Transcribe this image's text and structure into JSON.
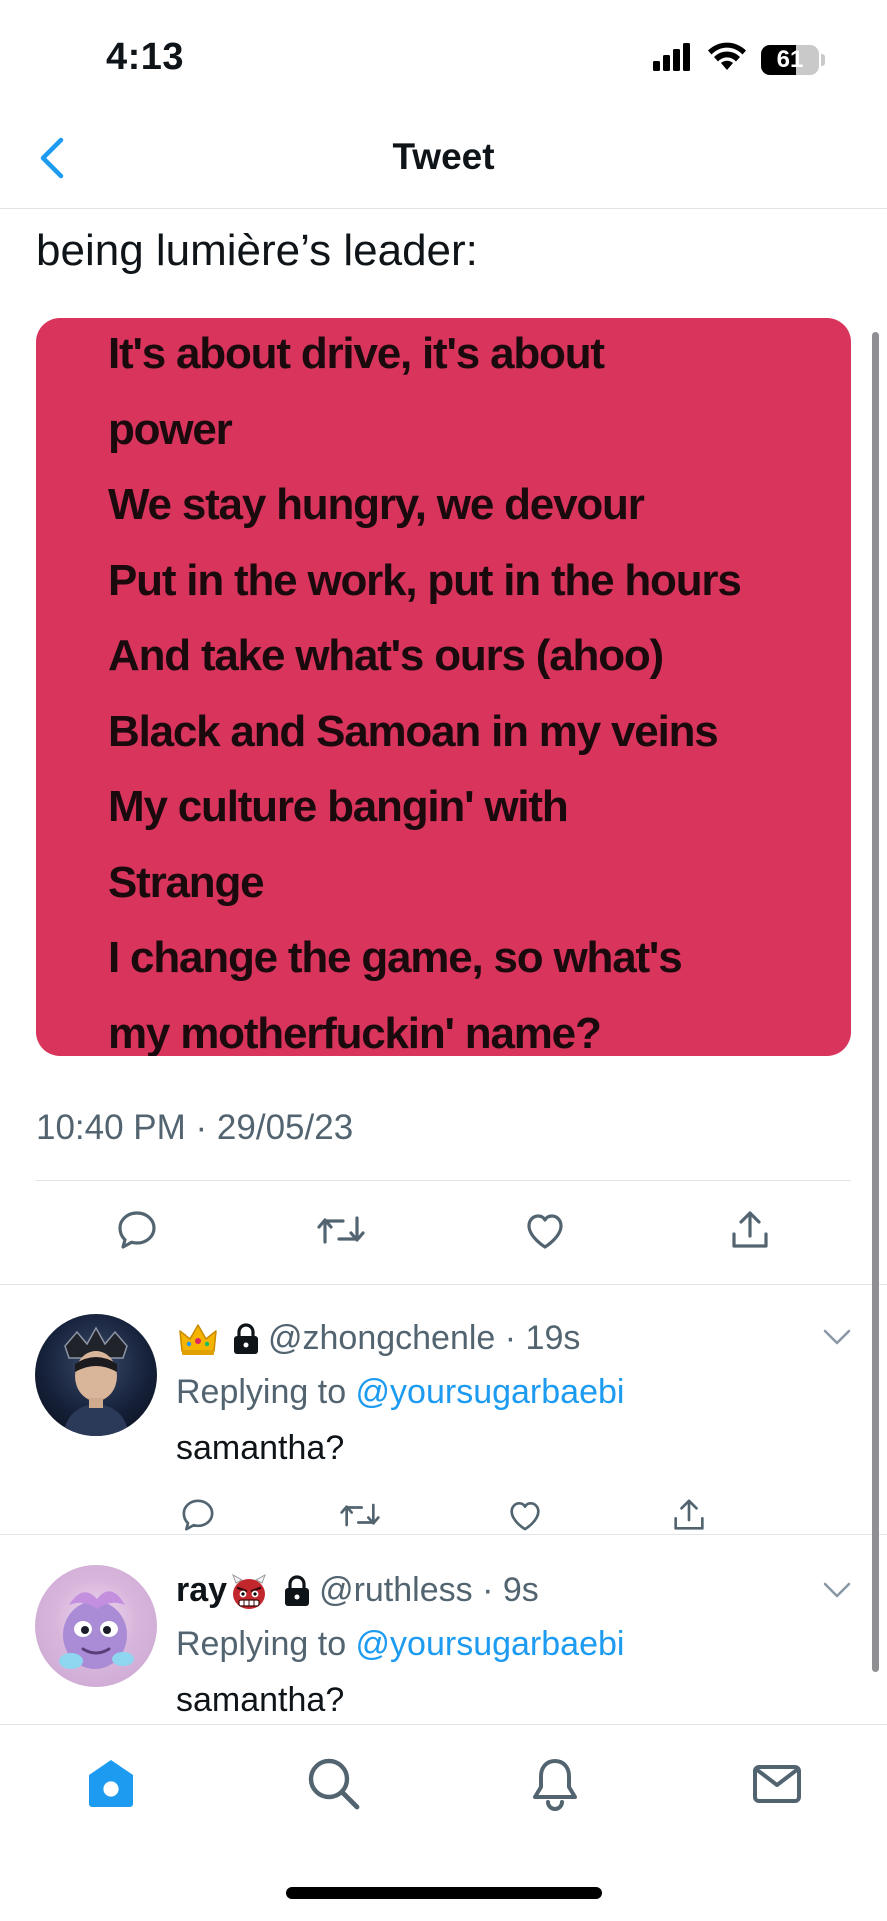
{
  "status_bar": {
    "time": "4:13",
    "battery_level": "61",
    "battery_fraction": 0.61
  },
  "nav": {
    "title": "Tweet"
  },
  "tweet": {
    "text": "being lumière’s leader:",
    "lyrics": [
      "It's about drive, it's about",
      "power",
      "We stay hungry, we devour",
      "Put in the work, put in the hours",
      "And take what's ours (ahoo)",
      "Black and Samoan in my veins",
      "My culture bangin' with",
      "Strange",
      "I change the game, so what's",
      "my motherfuckin' name?"
    ],
    "card_color": "#d8345c",
    "timestamp": "10:40 PM · 29/05/23"
  },
  "replies": [
    {
      "display_name": "",
      "badge_emoji": "👑",
      "handle_time": "@zhongchenle · 19s",
      "replying_prefix": "Replying to ",
      "replying_to": "@yoursugarbaebi",
      "text": "samantha?"
    },
    {
      "display_name": "ray",
      "badge_emoji": "👹",
      "handle_time": "@ruthless · 9s",
      "replying_prefix": "Replying to ",
      "replying_to": "@yoursugarbaebi",
      "text": "samantha?"
    }
  ],
  "icons": {
    "back": "chevron-left-icon",
    "reply": "comment-icon",
    "retweet": "retweet-icon",
    "like": "heart-icon",
    "share": "share-icon",
    "home": "home-icon",
    "search": "search-icon",
    "notifications": "bell-icon",
    "messages": "mail-icon"
  },
  "colors": {
    "accent": "#1d9bf0",
    "secondary_text": "#536471",
    "primary_text": "#0f1419"
  }
}
